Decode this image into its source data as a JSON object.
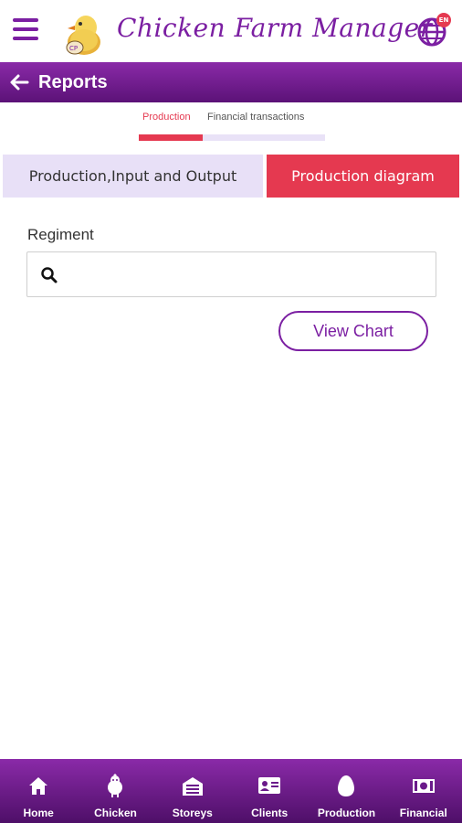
{
  "header": {
    "app_title": "Chicken Farm Manager",
    "lang_badge": "EN"
  },
  "page": {
    "title": "Reports"
  },
  "top_tabs": {
    "production": "Production",
    "financial": "Financial transactions"
  },
  "segments": {
    "left": "Production,Input and Output",
    "right": "Production diagram"
  },
  "form": {
    "regiment_label": "Regiment",
    "search_value": "",
    "view_chart": "View Chart"
  },
  "bottom_nav": [
    {
      "label": "Home",
      "icon": "home-icon"
    },
    {
      "label": "Chicken",
      "icon": "chicken-icon"
    },
    {
      "label": "Storeys",
      "icon": "storeys-icon"
    },
    {
      "label": "Clients",
      "icon": "clients-icon"
    },
    {
      "label": "Production",
      "icon": "egg-icon"
    },
    {
      "label": "Financial",
      "icon": "money-icon"
    }
  ],
  "colors": {
    "accent_purple": "#7b1fa2",
    "accent_red": "#e53950",
    "segment_inactive": "#e8e0f7"
  }
}
